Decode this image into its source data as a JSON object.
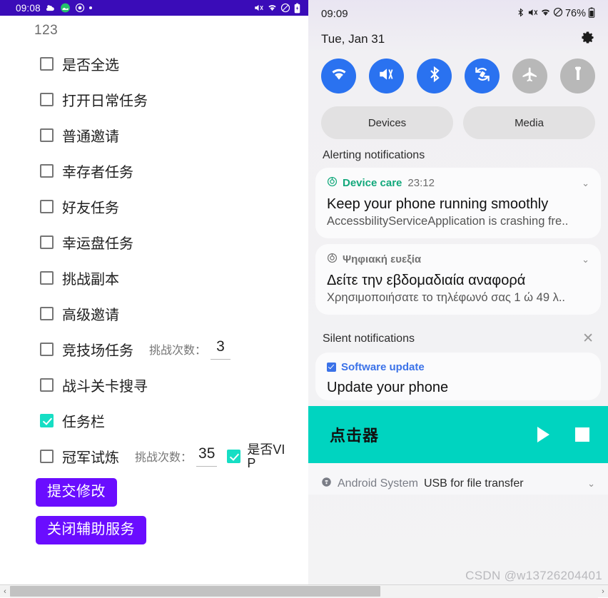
{
  "left_panel": {
    "status_bar": {
      "time": "09:08",
      "left_icons": [
        "weather-cloud-icon",
        "green-circle-icon",
        "target-icon",
        "dot-icon"
      ],
      "right_icons": [
        "mute-icon",
        "wifi-icon",
        "do-not-disturb-icon",
        "battery-charging-icon"
      ],
      "background_color": "#3a0cb8"
    },
    "title": "123",
    "checkbox_rows": [
      {
        "label": "是否全选",
        "checked": false
      },
      {
        "label": "打开日常任务",
        "checked": false
      },
      {
        "label": "普通邀请",
        "checked": false
      },
      {
        "label": "幸存者任务",
        "checked": false
      },
      {
        "label": "好友任务",
        "checked": false
      },
      {
        "label": "幸运盘任务",
        "checked": false
      },
      {
        "label": "挑战副本",
        "checked": false
      },
      {
        "label": "高级邀请",
        "checked": false
      },
      {
        "label": "竞技场任务",
        "checked": false,
        "count_label": "挑战次数：",
        "count_value": "3"
      },
      {
        "label": "战斗关卡搜寻",
        "checked": false
      },
      {
        "label": "任务栏",
        "checked": true
      },
      {
        "label": "冠军试炼",
        "checked": false,
        "count_label": "挑战次数：",
        "count_value": "35",
        "vip_checked": true,
        "vip_label": "是否VIP"
      }
    ],
    "buttons": [
      {
        "label": "提交修改"
      },
      {
        "label": "关闭辅助服务"
      }
    ],
    "accent_color": "#6a0dff",
    "checked_color": "#16dec4"
  },
  "right_panel": {
    "status_bar": {
      "time": "09:09",
      "battery": "76%",
      "icons": [
        "bluetooth-icon",
        "mute-icon",
        "wifi-icon",
        "do-not-disturb-icon",
        "battery-icon"
      ]
    },
    "date": "Tue, Jan 31",
    "settings_icon": "gear-icon",
    "quick_toggles": [
      {
        "name": "wifi-toggle",
        "icon": "wifi-icon",
        "on": true
      },
      {
        "name": "sound-toggle",
        "icon": "mute-vibrate-icon",
        "on": true
      },
      {
        "name": "bluetooth-toggle",
        "icon": "bluetooth-icon",
        "on": true
      },
      {
        "name": "auto-rotate-toggle",
        "icon": "auto-rotate-icon",
        "on": true
      },
      {
        "name": "airplane-toggle",
        "icon": "airplane-icon",
        "on": false
      },
      {
        "name": "flashlight-toggle",
        "icon": "flashlight-icon",
        "on": false
      }
    ],
    "pills": [
      {
        "label": "Devices"
      },
      {
        "label": "Media"
      }
    ],
    "alerting_header": "Alerting notifications",
    "alerting_notifications": [
      {
        "app": "Device care",
        "time": "23:12",
        "title": "Keep your phone running smoothly",
        "body": "AccessbilityServiceApplication is crashing fre..",
        "app_color": "#12a87b",
        "icon": "device-care-icon"
      },
      {
        "app": "Ψηφιακή ευεξία",
        "time": "",
        "title": "Δείτε την εβδομαδιαία αναφορά",
        "body": "Χρησιμοποιήσατε το τηλέφωνό σας 1 ώ 49 λ..",
        "app_color": "#737373",
        "icon": "digital-wellbeing-icon"
      }
    ],
    "silent_header": "Silent notifications",
    "silent_notifications": [
      {
        "app": "Software update",
        "title": "Update your phone",
        "app_color": "#3b72e8",
        "icon": "software-update-icon"
      }
    ],
    "teal_banner": {
      "title": "点击器",
      "play_icon": "play-icon",
      "stop_icon": "stop-icon",
      "background_color": "#00d4c0"
    },
    "system_row": {
      "app": "Android System",
      "text": "USB for file transfer",
      "icon": "android-system-icon"
    },
    "watermark": "CSDN @w13726204401"
  },
  "scrollbar": {
    "left_arrow": "‹",
    "right_arrow": "›"
  }
}
